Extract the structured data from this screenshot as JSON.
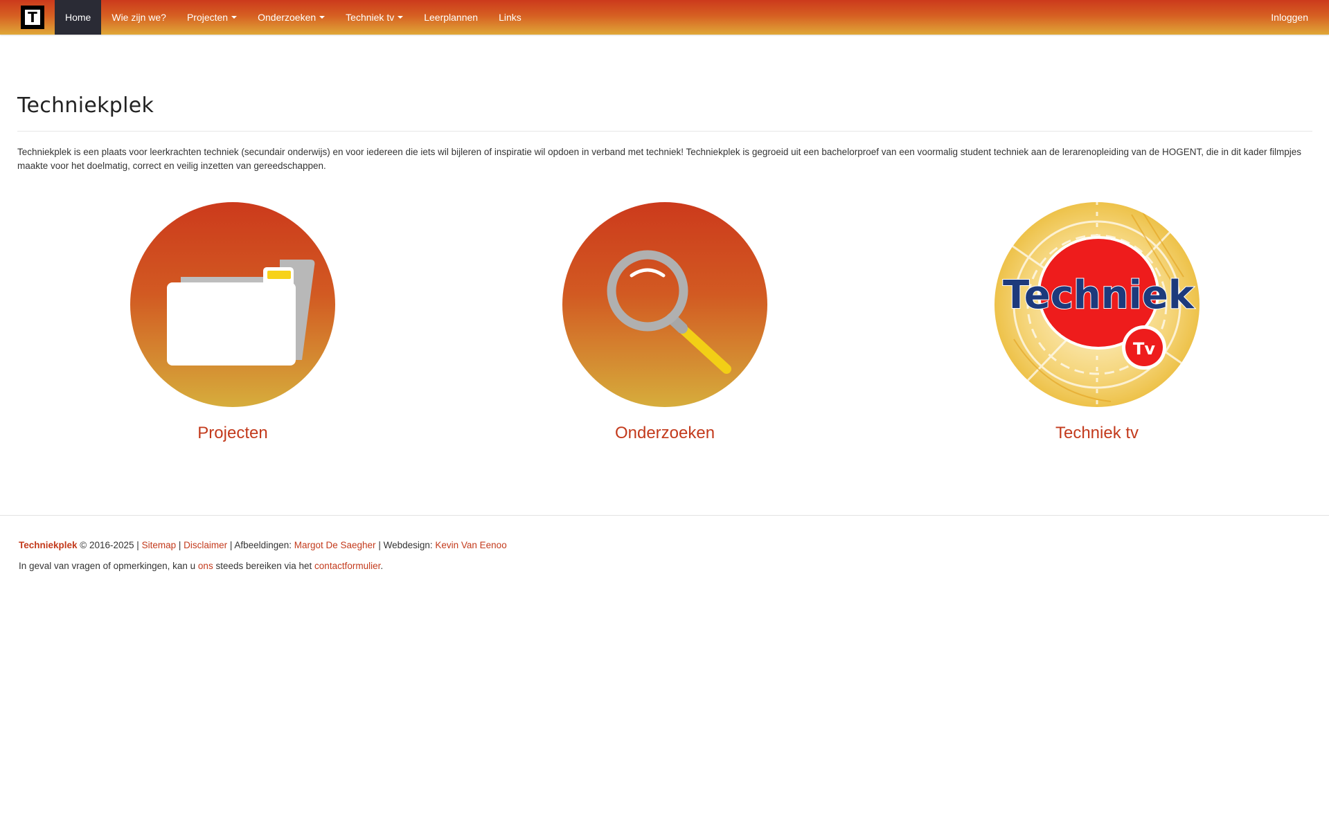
{
  "colors": {
    "accent": "#c33a1c",
    "navbar_top": "#cc3a1c",
    "navbar_bottom": "#e0a838",
    "nav_active_bg": "#2a2b35"
  },
  "navbar": {
    "brand_letter": "T",
    "items": [
      {
        "label": "Home",
        "active": true
      },
      {
        "label": "Wie zijn we?"
      },
      {
        "label": "Projecten",
        "dropdown": true
      },
      {
        "label": "Onderzoeken",
        "dropdown": true
      },
      {
        "label": "Techniek tv",
        "dropdown": true
      },
      {
        "label": "Leerplannen"
      },
      {
        "label": "Links"
      }
    ],
    "login_label": "Inloggen"
  },
  "page": {
    "title": "Techniekplek",
    "intro": "Techniekplek is een plaats voor leerkrachten techniek (secundair onderwijs) en voor iedereen die iets wil bijleren of inspiratie wil opdoen in verband met techniek! Techniekplek is gegroeid uit een bachelorproef van een voormalig student techniek aan de lerarenopleiding van de HOGENT, die in dit kader filmpjes maakte voor het doelmatig, correct en veilig inzetten van gereedschappen."
  },
  "tiles": [
    {
      "label": "Projecten",
      "icon": "folder-icon"
    },
    {
      "label": "Onderzoeken",
      "icon": "magnifier-icon"
    },
    {
      "label": "Techniek tv",
      "icon": "techniek-tv-logo",
      "logo_text": "Techniek",
      "logo_sub": "Tv"
    }
  ],
  "footer": {
    "brand": "Techniekplek",
    "copyright": " © 2016-2025 | ",
    "sitemap": "Sitemap",
    "sep1": " | ",
    "disclaimer": "Disclaimer",
    "images_prefix": " | Afbeeldingen: ",
    "images_author": "Margot De Saegher",
    "webdesign_prefix": " | Webdesign: ",
    "webdesign_author": "Kevin Van Eenoo",
    "contact_prefix": "In geval van vragen of opmerkingen, kan u ",
    "contact_ons": "ons",
    "contact_mid": " steeds bereiken via het ",
    "contact_form": "contactformulier",
    "contact_suffix": "."
  }
}
